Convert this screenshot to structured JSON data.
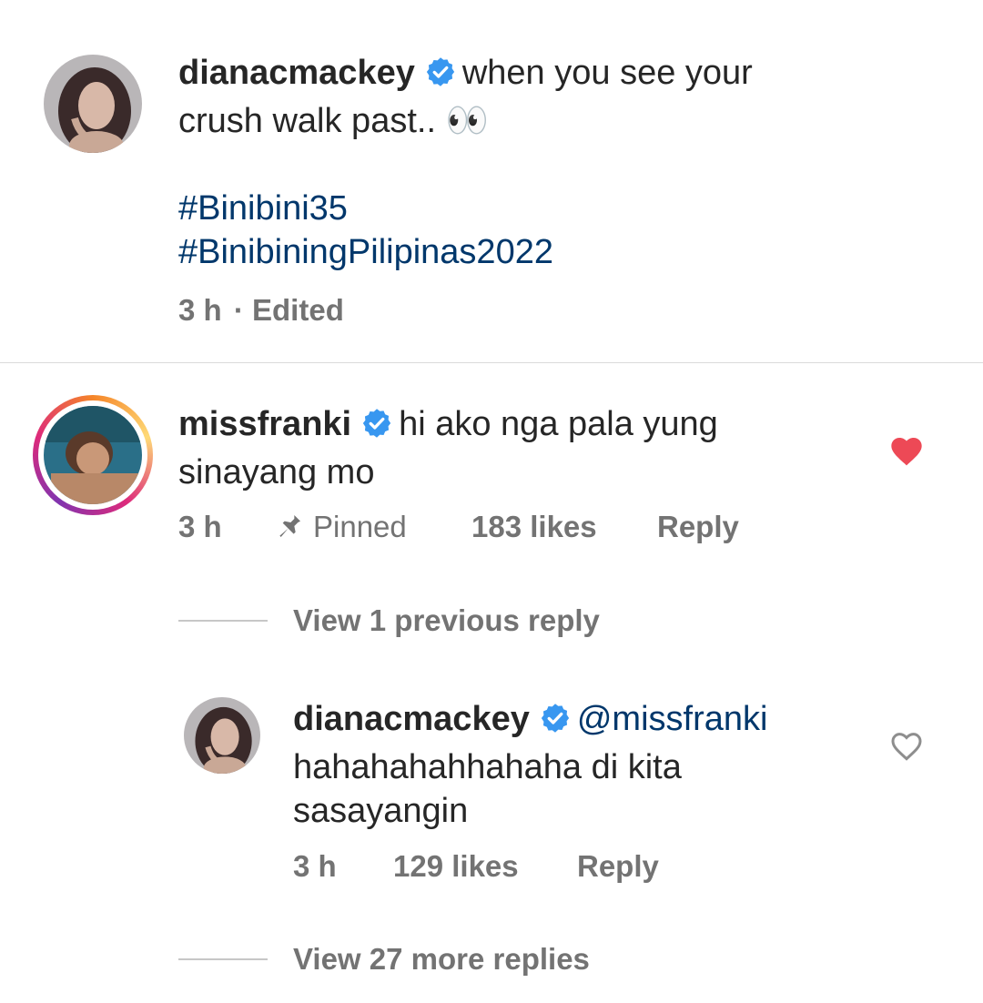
{
  "caption": {
    "username": "dianacmackey",
    "line1": "when you see your",
    "line2": "crush walk past.. 👀",
    "hashtags": [
      "#Binibini35",
      "#BinibiningPilipinas2022"
    ],
    "time": "3 h",
    "edited": "· Edited"
  },
  "comment": {
    "username": "missfranki",
    "line1": "hi ako nga pala yung",
    "line2": "sinayang mo",
    "time": "3 h",
    "pinned": "Pinned",
    "likes": "183 likes",
    "reply": "Reply",
    "liked": true,
    "view_previous": "View 1 previous reply"
  },
  "reply": {
    "username": "dianacmackey",
    "mention": "@missfranki",
    "line1": "hahahahahhahaha di kita",
    "line2": "sasayangin",
    "time": "3 h",
    "likes": "129 likes",
    "reply": "Reply",
    "liked": false,
    "view_more": "View 27 more replies"
  },
  "colors": {
    "verified": "#3897f0",
    "liked_heart": "#ed4956",
    "hashtag": "#00376b",
    "meta": "#737373"
  }
}
